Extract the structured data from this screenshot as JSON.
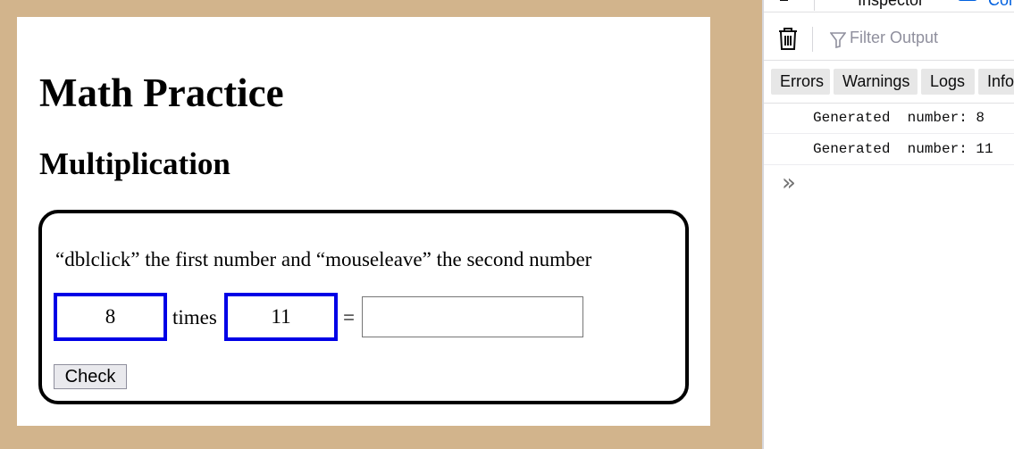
{
  "page": {
    "title": "Math Practice",
    "section_title": "Multiplication",
    "instructions": "“dblclick” the first number and “mouseleave” the second number",
    "first_number": "8",
    "operator_label": "times",
    "second_number": "11",
    "equals_label": "=",
    "answer_value": "",
    "check_label": "Check"
  },
  "devtools": {
    "tabs": {
      "inspector": "Inspector",
      "console": "Console"
    },
    "filter_placeholder": "Filter Output",
    "levels": [
      "Errors",
      "Warnings",
      "Logs",
      "Info"
    ],
    "logs": [
      "Generated  number: 8",
      "Generated  number: 11"
    ],
    "prompt_symbol": "»",
    "icons": [
      "pick-element-icon",
      "inspector-icon",
      "console-icon",
      "trash-icon",
      "filter-icon"
    ]
  },
  "colors": {
    "page_background": "#d2b48c",
    "number_border": "#0000e6",
    "console_tab": "#0060df"
  }
}
